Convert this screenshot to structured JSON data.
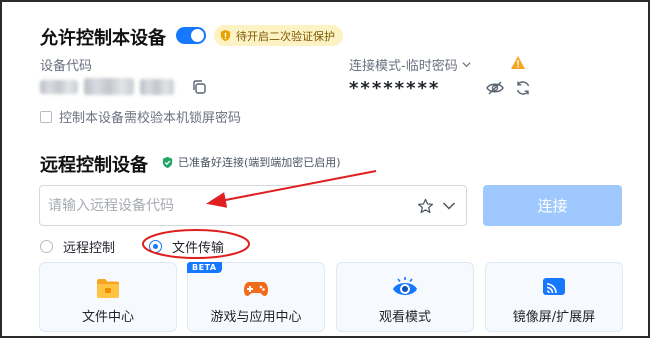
{
  "allow_control": {
    "title": "允许控制本设备",
    "toggle_on": true,
    "badge": "待开启二次验证保护",
    "device_code_label": "设备代码",
    "device_code_value": "",
    "mode_label": "连接模式-临时密码",
    "password_masked": "********",
    "lock_screen_checkbox_label": "控制本设备需校验本机锁屏密码",
    "lock_screen_checked": false
  },
  "remote": {
    "title": "远程控制设备",
    "ready_status": "已准备好连接(端到端加密已启用)",
    "input_placeholder": "请输入远程设备代码",
    "input_value": "",
    "connect_label": "连接",
    "options": [
      {
        "label": "远程控制",
        "selected": false
      },
      {
        "label": "文件传输",
        "selected": true
      }
    ]
  },
  "cards": [
    {
      "label": "文件中心",
      "icon": "folder-icon",
      "badge": ""
    },
    {
      "label": "游戏与应用中心",
      "icon": "gamepad-icon",
      "badge": "BETA"
    },
    {
      "label": "观看模式",
      "icon": "eye-watch-icon",
      "badge": ""
    },
    {
      "label": "镜像屏/扩展屏",
      "icon": "cast-screen-icon",
      "badge": ""
    }
  ],
  "colors": {
    "accent": "#1677ff",
    "connect_disabled": "#9fc8ff",
    "badge_bg": "#fdf2c4",
    "annotation": "#e02020"
  }
}
